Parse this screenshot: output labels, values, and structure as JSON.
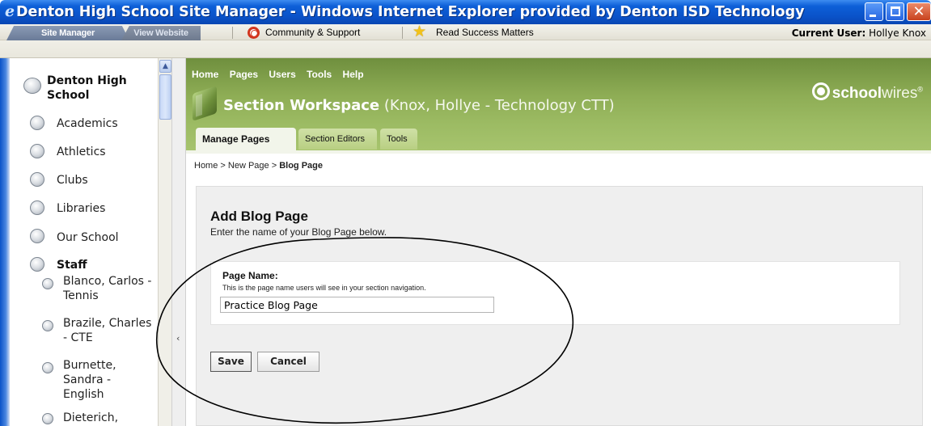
{
  "window": {
    "title": "Denton High School Site Manager - Windows Internet Explorer provided by Denton ISD Technology",
    "controls": [
      "minimize",
      "maximize",
      "close"
    ]
  },
  "toolbar": {
    "tabs": [
      {
        "label": "Site Manager",
        "active": true
      },
      {
        "label": "View Website",
        "active": false
      }
    ],
    "links": [
      {
        "label": "Community & Support",
        "icon": "lifesaver-icon"
      },
      {
        "label": "Read Success Matters",
        "icon": "star-icon"
      }
    ],
    "current_user_label": "Current User:",
    "current_user_name": "Hollye Knox"
  },
  "sidebar": {
    "school_line1": "Denton High",
    "school_line2": "School",
    "items": [
      {
        "label": "Academics"
      },
      {
        "label": "Athletics"
      },
      {
        "label": "Clubs"
      },
      {
        "label": "Libraries"
      },
      {
        "label": "Our School"
      },
      {
        "label": "Staff"
      }
    ],
    "staff": [
      {
        "line1": "Blanco, Carlos -",
        "line2": "Tennis"
      },
      {
        "line1": "Brazile, Charles",
        "line2": "- CTE"
      },
      {
        "line1": "Burnette,",
        "line2": "Sandra -",
        "line3": "English"
      },
      {
        "line1": "Dieterich,"
      }
    ]
  },
  "header": {
    "nav": [
      "Home",
      "Pages",
      "Users",
      "Tools",
      "Help"
    ],
    "logo_bold": "school",
    "logo_light": "wires",
    "logo_mark": "®",
    "workspace_title": "Section Workspace",
    "workspace_sub": "(Knox, Hollye - Technology CTT)",
    "tabs": [
      "Manage Pages",
      "Section Editors",
      "Tools"
    ]
  },
  "breadcrumb": {
    "home": "Home",
    "sep1": " > ",
    "mid": "New Page",
    "sep2": " > ",
    "current": "Blog Page"
  },
  "form": {
    "title": "Add Blog Page",
    "description": "Enter the name of your Blog Page below.",
    "field_label": "Page Name:",
    "field_help": "This is the page name users will see in your section navigation.",
    "field_value": "Practice Blog Page",
    "save_label": "Save",
    "cancel_label": "Cancel"
  },
  "colors": {
    "titlebar": "#0a52c8",
    "header_green": "#8ead55",
    "panel_bg": "#efefef"
  }
}
